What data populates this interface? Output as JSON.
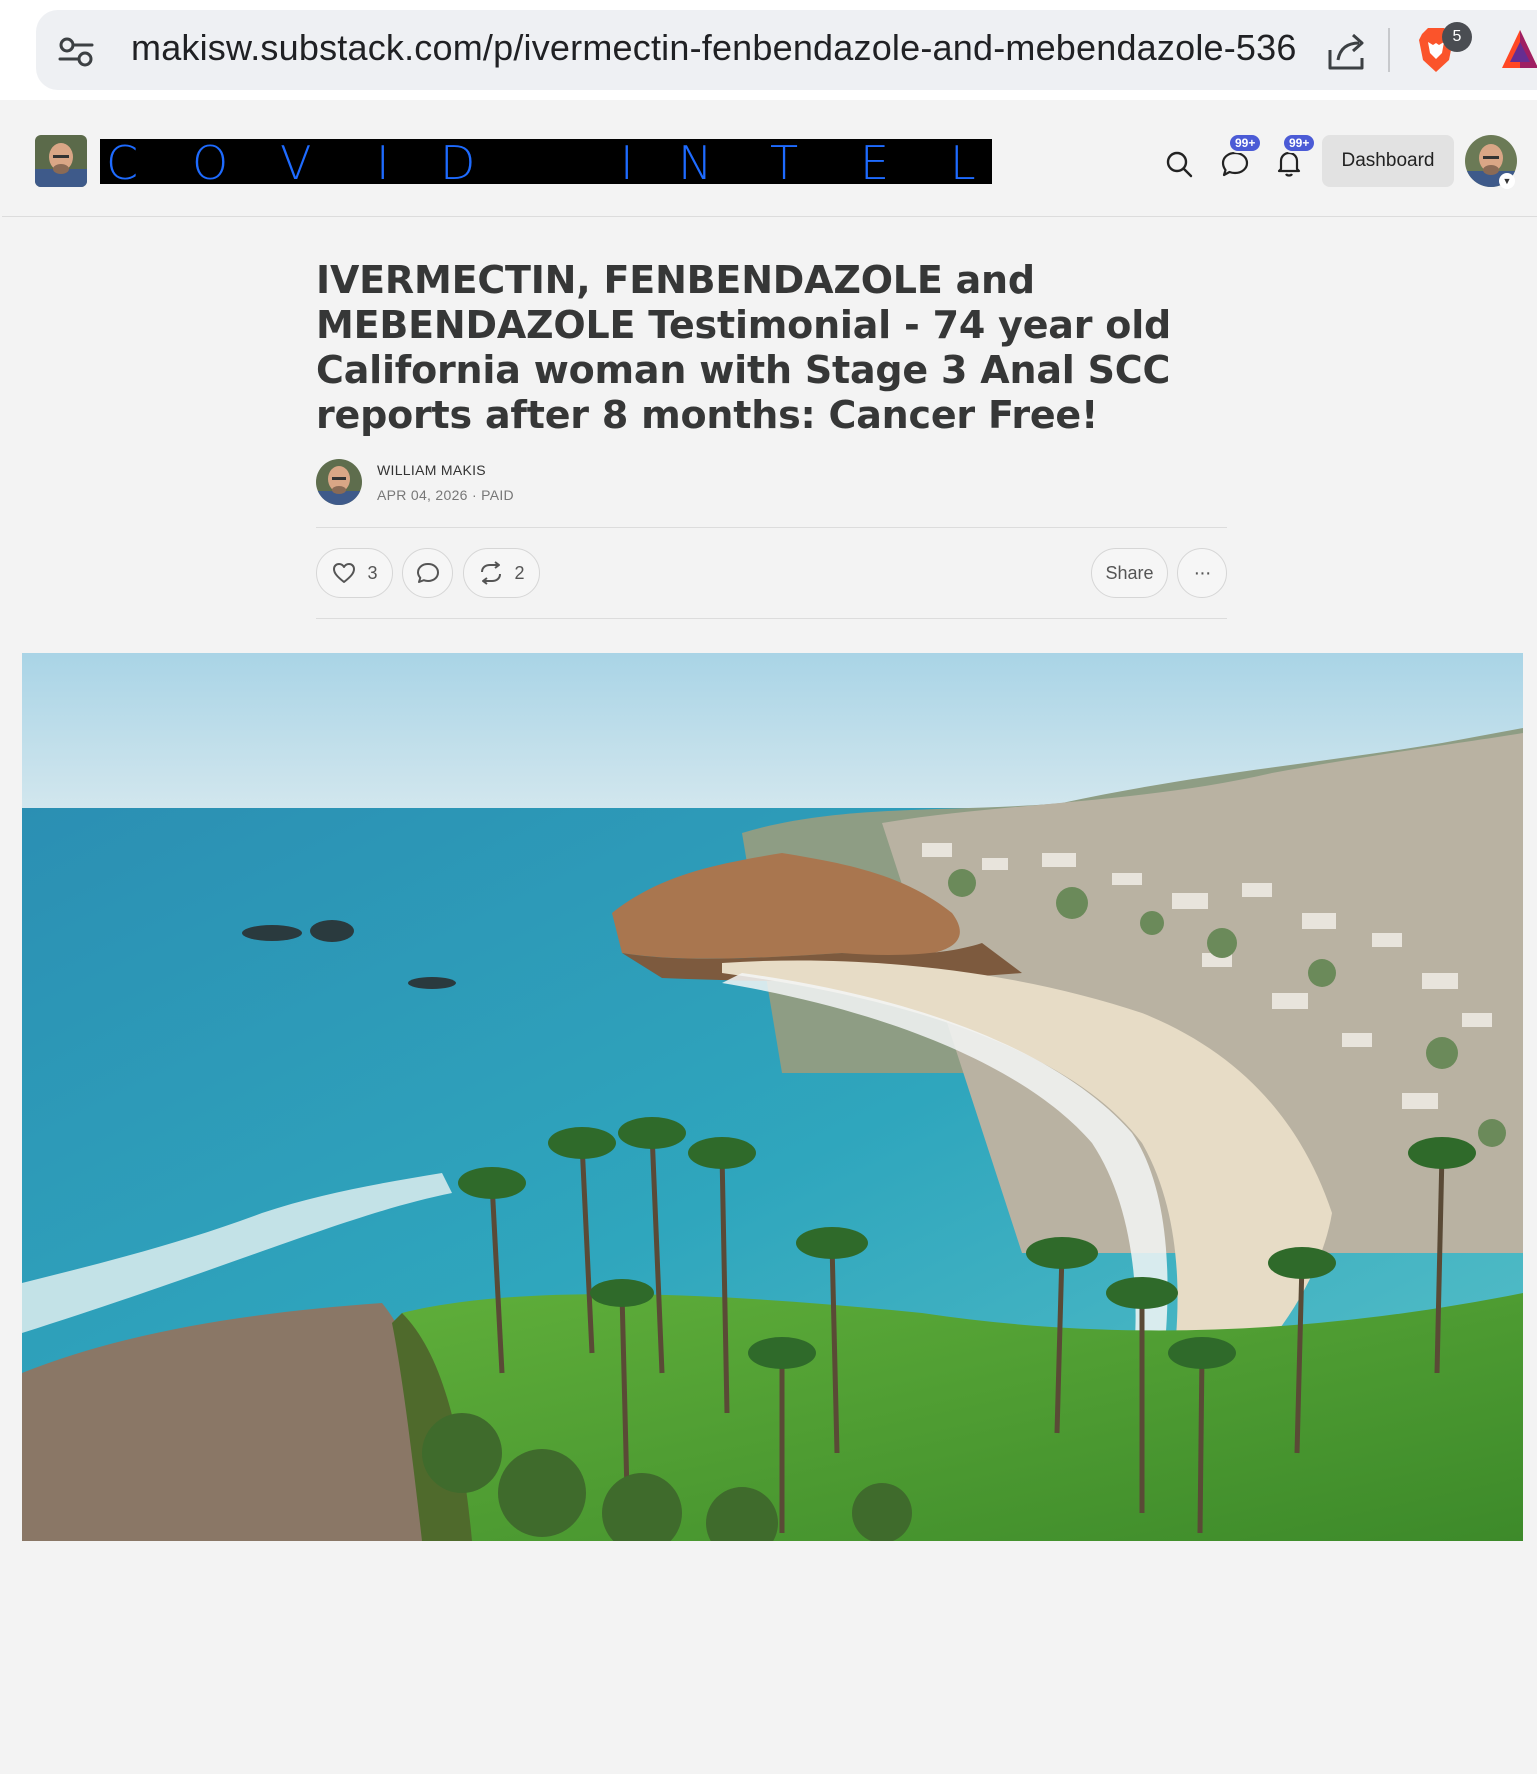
{
  "browser": {
    "url": "makisw.substack.com/p/ivermectin-fenbendazole-and-mebendazole-536",
    "shield_count": "5"
  },
  "header": {
    "logo_text": "COVID INTEL",
    "logo_letters": [
      "C",
      "O",
      "V",
      "I",
      "D",
      "I",
      "N",
      "T",
      "E",
      "L"
    ],
    "chat_badge": "99+",
    "notifications_badge": "99+",
    "dashboard_label": "Dashboard",
    "accent_color": "#1e6bff",
    "badge_color": "#4b5bd6"
  },
  "post": {
    "title": "IVERMECTIN, FENBENDAZOLE and MEBENDAZOLE Testimonial - 74 year old California woman with Stage 3 Anal SCC reports after 8 months: Cancer Free!",
    "author": "WILLIAM MAKIS",
    "date": "APR 04, 2026",
    "access": "PAID",
    "meta": "APR 04, 2026 · PAID",
    "likes": "3",
    "restacks": "2",
    "share_label": "Share",
    "more_label": "···"
  },
  "icons": {
    "site_settings": "tune-icon",
    "share_page": "share-icon",
    "brave_shield": "brave-lion-icon",
    "rewards": "bat-triangle-icon",
    "search": "search-icon",
    "chat": "chat-bubble-icon",
    "notifications": "bell-icon",
    "like": "heart-icon",
    "comment": "comment-icon",
    "restack": "restack-icon"
  }
}
